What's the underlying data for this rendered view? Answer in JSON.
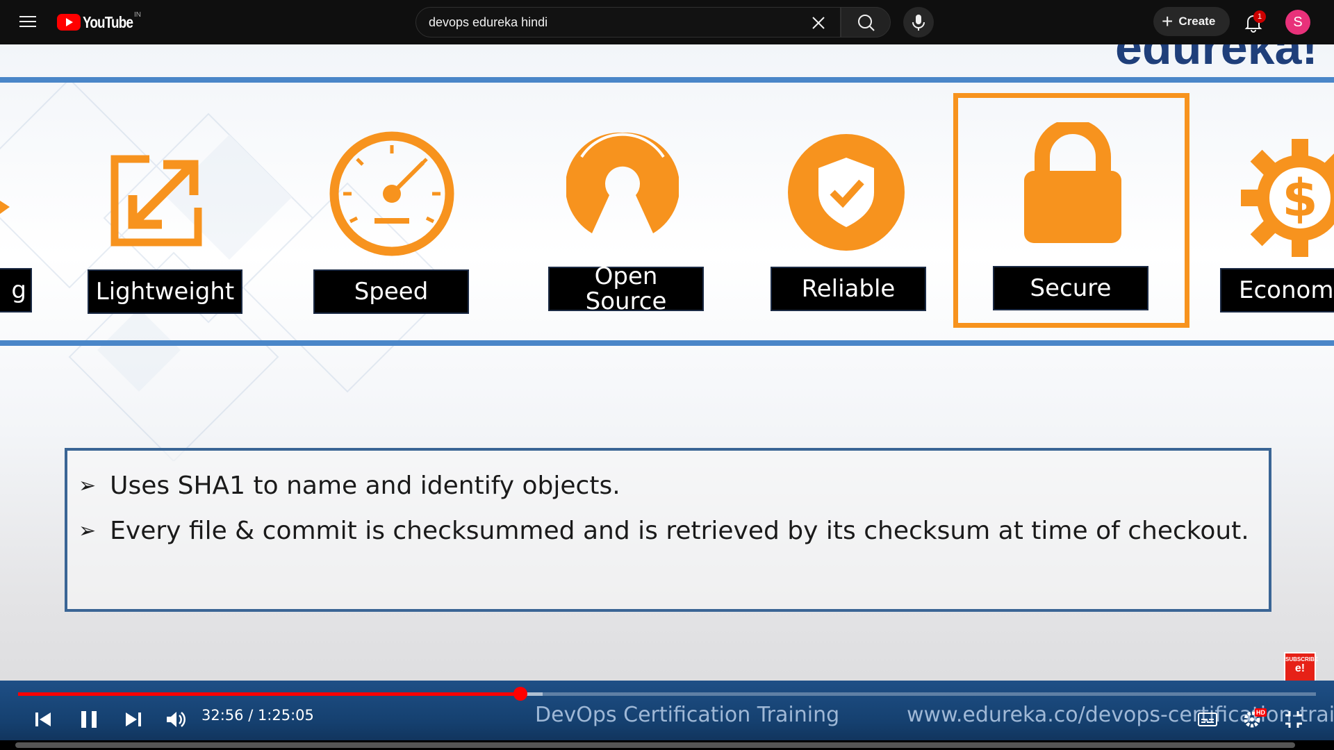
{
  "topbar": {
    "logo_text": "YouTube",
    "country_code": "IN",
    "search_value": "devops edureka hindi",
    "create_label": "Create",
    "notification_count": "1",
    "avatar_letter": "S"
  },
  "slide": {
    "brand_partial": "edureka!",
    "features": [
      {
        "label": "g"
      },
      {
        "label": "Lightweight"
      },
      {
        "label": "Speed"
      },
      {
        "label": "Open Source"
      },
      {
        "label": "Reliable"
      },
      {
        "label": "Secure"
      },
      {
        "label": "Economic"
      }
    ],
    "highlighted_feature": "Secure",
    "bullets": [
      "Uses SHA1 to name and identify objects.",
      "Every file & commit is checksummed and is retrieved by its checksum at time of checkout."
    ],
    "bullet_glyph": "➢",
    "accent_color": "#f7931e",
    "line_color": "#4a86c8"
  },
  "player": {
    "current_time": "32:56",
    "duration": "1:25:05",
    "time_display": "32:56 / 1:25:05",
    "progress_fraction": 0.387,
    "buffered_fraction": 0.404,
    "course_title": "DevOps Certification Training",
    "course_url": "www.edureka.co/devops-certification-training",
    "quality_badge": "HD",
    "subscribe_text": "SUBSCRIBE",
    "subscribe_logo": "e!"
  }
}
